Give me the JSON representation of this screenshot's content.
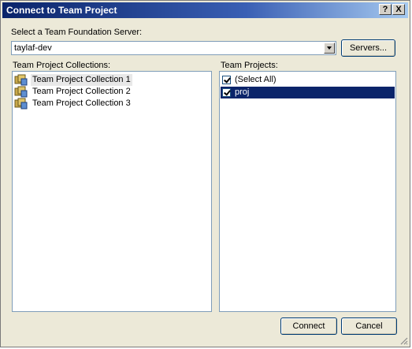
{
  "window": {
    "title": "Connect to Team Project",
    "help_label": "?",
    "close_label": "X"
  },
  "server": {
    "label": "Select a Team Foundation Server:",
    "value": "taylaf-dev",
    "servers_button": "Servers..."
  },
  "collections": {
    "label": "Team Project Collections:",
    "items": [
      {
        "label": "Team Project Collection 1",
        "selected": true
      },
      {
        "label": "Team Project Collection 2",
        "selected": false
      },
      {
        "label": "Team Project Collection 3",
        "selected": false
      }
    ]
  },
  "projects": {
    "label": "Team Projects:",
    "items": [
      {
        "label": "(Select All)",
        "checked": true,
        "selected": false
      },
      {
        "label": "proj",
        "checked": true,
        "selected": true
      }
    ]
  },
  "footer": {
    "connect_label": "Connect",
    "cancel_label": "Cancel"
  },
  "icons": {
    "collection": "team-collection-icon",
    "grip": "resize-grip-icon"
  },
  "colors": {
    "titlebar": "#0a246a",
    "selection": "#0a246a",
    "face": "#ece9d8"
  }
}
